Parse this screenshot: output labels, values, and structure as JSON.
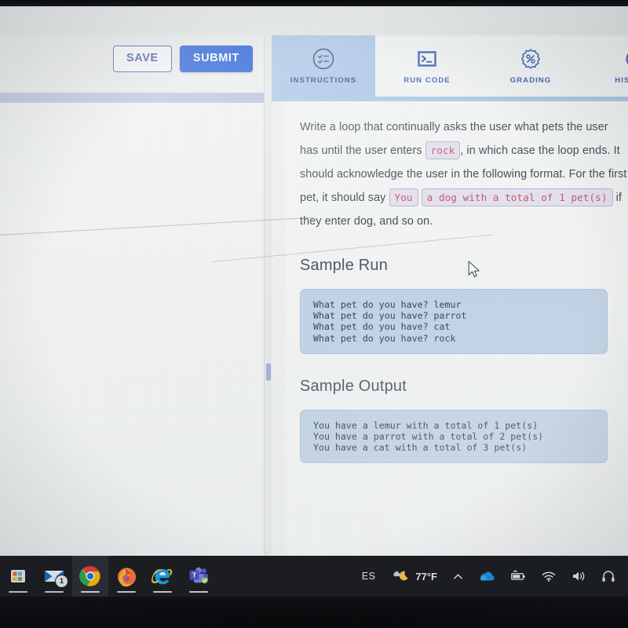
{
  "app": {
    "left_pane": {
      "save_label": "SAVE",
      "submit_label": "SUBMIT",
      "editor_content": ""
    },
    "tabs": [
      {
        "id": "instructions",
        "label": "INSTRUCTIONS",
        "icon": "checklist-circle-icon",
        "active": true
      },
      {
        "id": "run-code",
        "label": "RUN CODE",
        "icon": "terminal-icon",
        "active": false
      },
      {
        "id": "grading",
        "label": "GRADING",
        "icon": "percent-badge-icon",
        "active": false
      },
      {
        "id": "history",
        "label": "HISTORY",
        "icon": "history-circular-arrow-icon",
        "active": false
      }
    ],
    "instructions": {
      "paragraph": {
        "part_1": "Write a loop that continually asks the user what pets the user has until the",
        "code_1": "rock",
        "part_2": ", in which case the loop ends. It should acknowledge",
        "part_3": "the user in the following format. For the first pet, it should say",
        "code_2": "You",
        "code_3": "a dog with a total of 1 pet(s)",
        "part_4": "if they enter dog, and so on.",
        "lead_2": "user enters"
      },
      "sample_run": {
        "title": "Sample Run",
        "code": "What pet do you have? lemur\nWhat pet do you have? parrot\nWhat pet do you have? cat\nWhat pet do you have? rock"
      },
      "sample_output": {
        "title": "Sample Output",
        "code": "You have a lemur with a total of 1 pet(s)\nYou have a parrot with a total of 2 pet(s)\nYou have a cat with a total of 3 pet(s)"
      }
    }
  },
  "taskbar": {
    "apps": [
      {
        "id": "store",
        "name": "microsoft-store-icon",
        "badge": "",
        "state": "pinned"
      },
      {
        "id": "mail",
        "name": "mail-icon",
        "badge": "1",
        "state": "pinned"
      },
      {
        "id": "chrome",
        "name": "chrome-icon",
        "badge": "",
        "state": "active"
      },
      {
        "id": "firefox",
        "name": "firefox-icon",
        "badge": "",
        "state": "pinned"
      },
      {
        "id": "edge-ie",
        "name": "internet-explorer-icon",
        "badge": "",
        "state": "pinned"
      },
      {
        "id": "teams",
        "name": "microsoft-teams-icon",
        "badge": "",
        "state": "pinned"
      }
    ],
    "tray": {
      "language": "ES",
      "weather_temp": "77°F",
      "weather_icon": "night-cloud-icon",
      "overflow_icon": "chevron-up-icon",
      "onedrive_icon": "onedrive-cloud-icon",
      "battery_icon": "battery-icon",
      "network_icon": "wifi-icon",
      "volume_icon": "speaker-icon",
      "headphones_icon": "headphones-icon"
    }
  },
  "colors": {
    "accent_blue": "#1051d8",
    "tab_active": "#a9c6e8",
    "code_block": "#c3d4e8",
    "inline_code_text": "#c8506a",
    "lavender_bar": "#aab4da"
  }
}
